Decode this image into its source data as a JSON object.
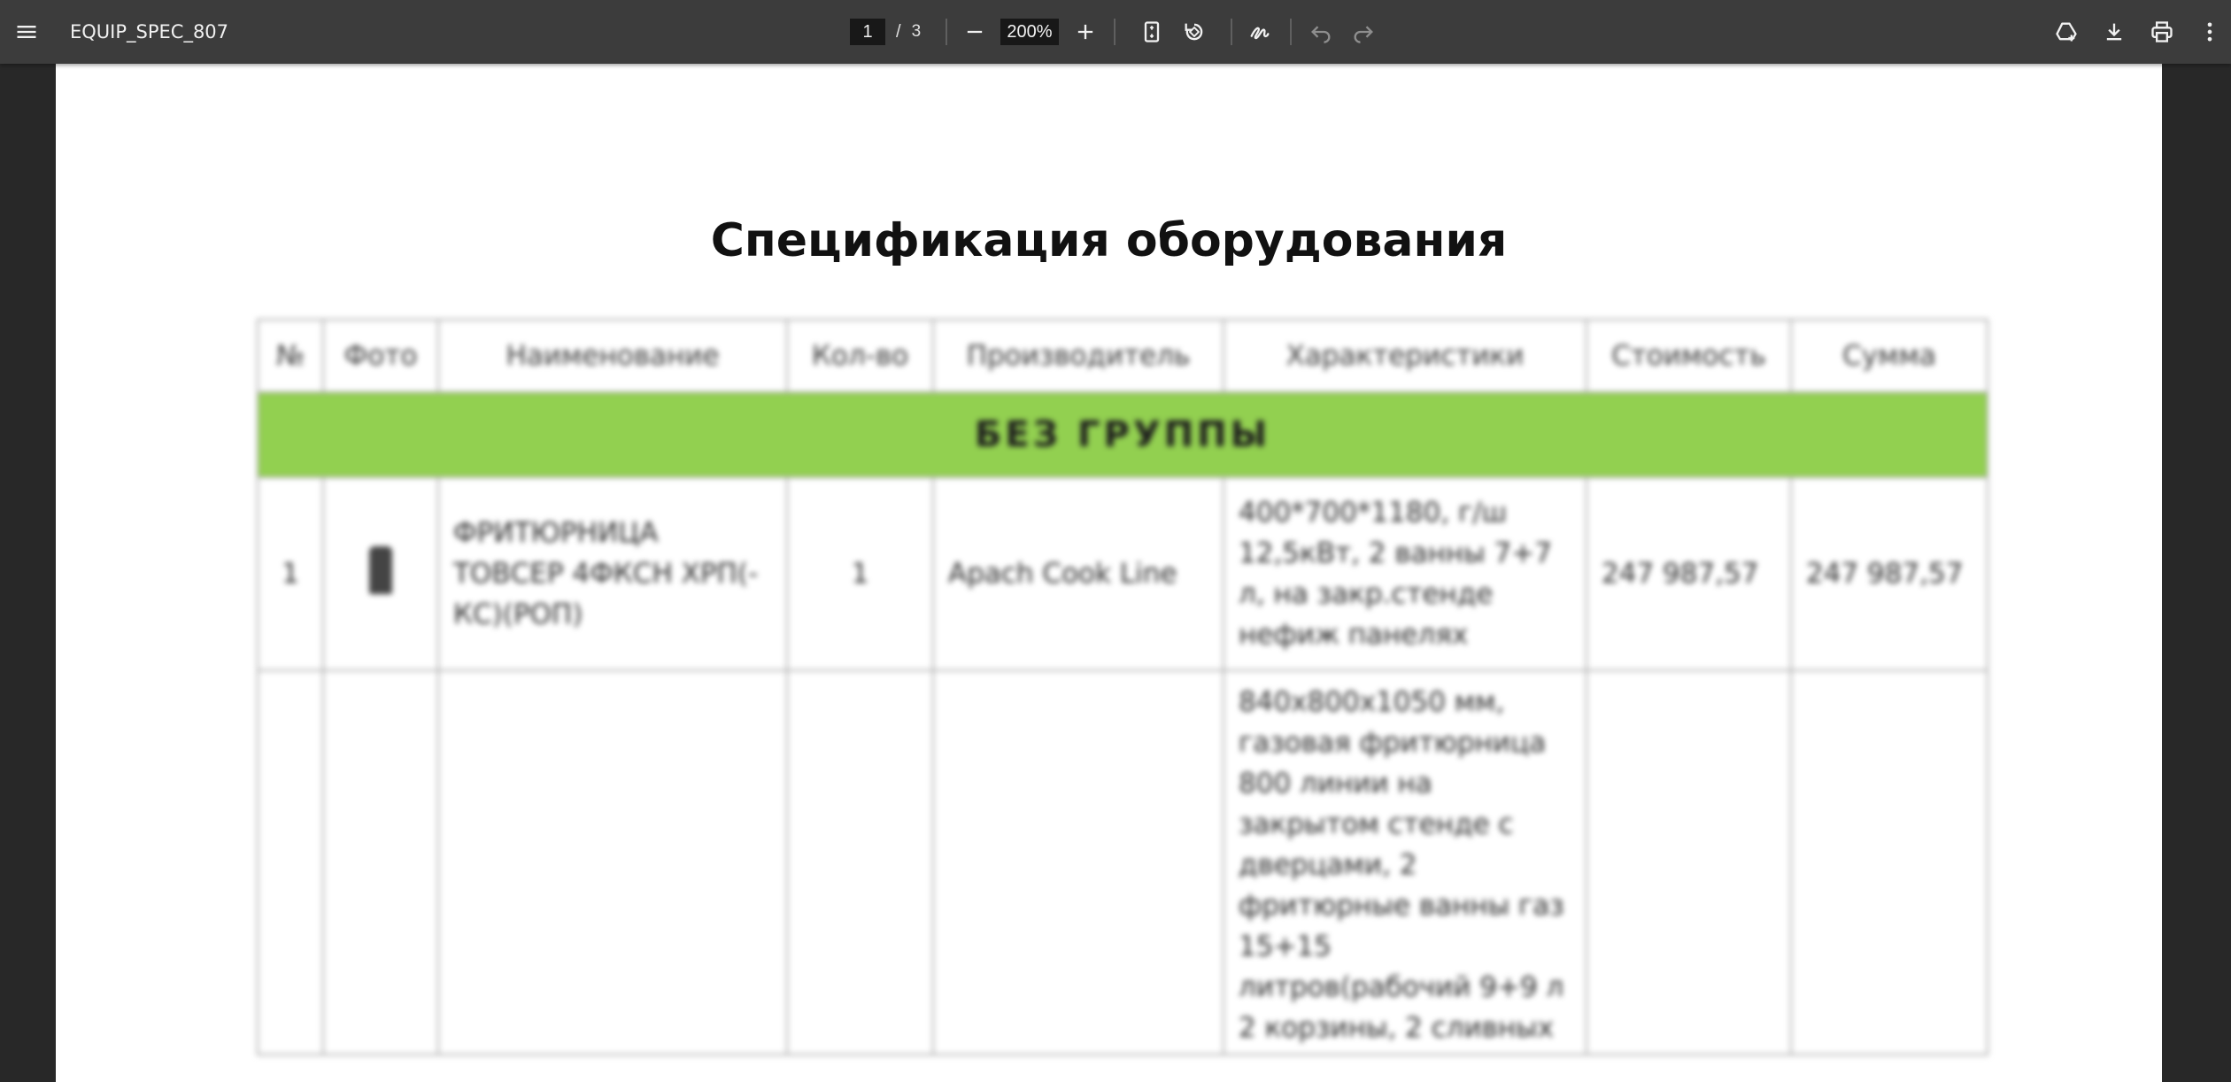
{
  "toolbar": {
    "menu_icon": "menu-icon",
    "title": "EQUIP_SPEC_807",
    "page_current": "1",
    "page_separator": "/",
    "page_total": "3",
    "zoom_out_icon": "minus-icon",
    "zoom_value": "200%",
    "zoom_in_icon": "plus-icon",
    "fit_page_icon": "fit-page-icon",
    "rotate_icon": "rotate-icon",
    "annotate_icon": "pen-icon",
    "undo_icon": "undo-icon",
    "redo_icon": "redo-icon",
    "save_to_drive_icon": "drive-add-icon",
    "download_icon": "download-icon",
    "print_icon": "print-icon",
    "more_icon": "more-vert-icon"
  },
  "document": {
    "title": "Спецификация оборудования",
    "table": {
      "headers": [
        "№",
        "Фото",
        "Наименование",
        "Кол-во",
        "Производитель",
        "Характеристики",
        "Стоимость",
        "Сумма"
      ],
      "group_label": "БЕЗ ГРУППЫ",
      "rows": [
        {
          "num": "1",
          "name": "ФРИТЮРНИЦА ТОВСЕР 4ФКСН ХРП(-КС)(РОП)",
          "qty": "1",
          "maker": "Apach Cook Line",
          "specs": "400*700*1180, г/ш 12,5кВт, 2 ванны 7+7 л, на закр.стенде нефиж панелях",
          "price": "247 987,57",
          "sum": "247 987,57"
        },
        {
          "num": "",
          "name": "",
          "qty": "",
          "maker": "",
          "specs": "840х800х1050 мм, газовая фритюрница 800 линии на закрытом стенде с дверцами, 2 фритюрные ванны газ 15+15 литров(рабочий 9+9 л 2 корзины, 2 сливных",
          "price": "",
          "sum": ""
        }
      ]
    }
  },
  "colors": {
    "toolbar_bg": "#3c3c3c",
    "viewer_bg": "#282828",
    "group_row_bg": "#92d050"
  }
}
